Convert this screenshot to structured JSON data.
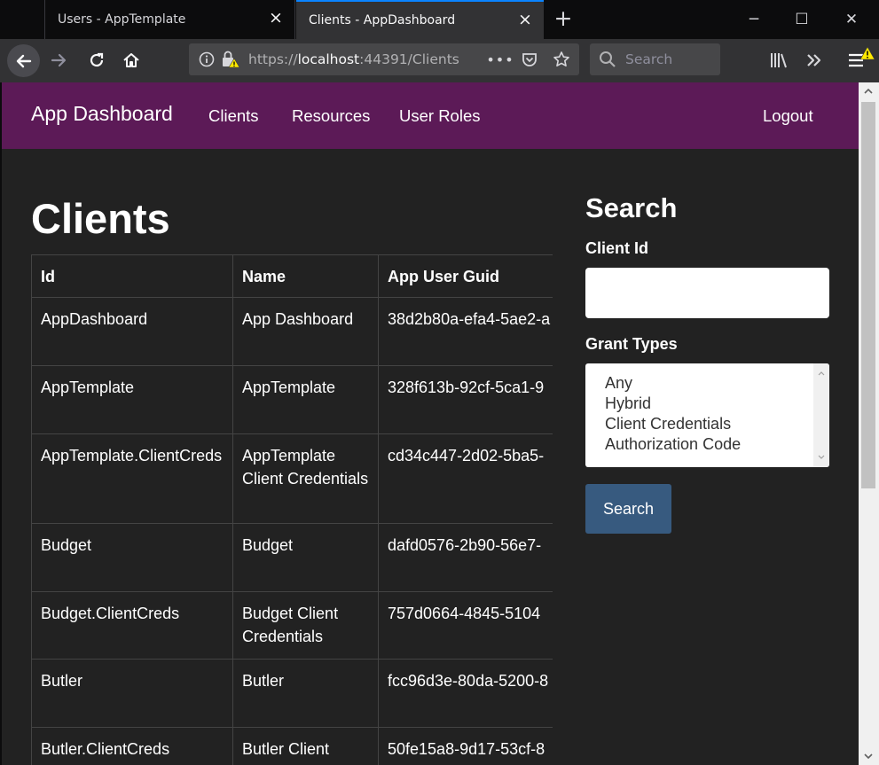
{
  "browser": {
    "tabs": [
      {
        "title": "Users - AppTemplate",
        "active": false
      },
      {
        "title": "Clients - AppDashboard",
        "active": true
      }
    ],
    "new_tab_icon": "plus-icon",
    "window_controls": {
      "minimize": "─",
      "maximize": "☐",
      "close": "✕"
    },
    "url": {
      "prefix": "https://",
      "host": "localhost",
      "rest": ":44391/Clients"
    },
    "search_placeholder": "Search",
    "icons": [
      "back-arrow-icon",
      "forward-arrow-icon",
      "reload-icon",
      "home-icon",
      "info-icon",
      "insecure-lock-icon",
      "page-actions-icon",
      "pocket-icon",
      "bookmark-star-icon",
      "search-icon",
      "library-icon",
      "overflow-icon",
      "hamburger-menu-icon"
    ]
  },
  "site": {
    "brand": "App Dashboard",
    "nav": [
      "Clients",
      "Resources",
      "User Roles"
    ],
    "logout": "Logout",
    "nav_bg": "#5c1a57"
  },
  "main": {
    "title": "Clients",
    "columns": [
      "Id",
      "Name",
      "App User Guid"
    ],
    "rows": [
      [
        "AppDashboard",
        "App Dashboard",
        "38d2b80a-efa4-5ae2-a"
      ],
      [
        "AppTemplate",
        "AppTemplate",
        "328f613b-92cf-5ca1-9"
      ],
      [
        "AppTemplate.ClientCreds",
        "AppTemplate Client Credentials",
        "cd34c447-2d02-5ba5-"
      ],
      [
        "Budget",
        "Budget",
        "dafd0576-2b90-56e7-"
      ],
      [
        "Budget.ClientCreds",
        "Budget Client Credentials",
        "757d0664-4845-5104"
      ],
      [
        "Butler",
        "Butler",
        "fcc96d3e-80da-5200-8"
      ],
      [
        "Butler.ClientCreds",
        "Butler Client",
        "50fe15a8-9d17-53cf-8"
      ]
    ]
  },
  "sidebar": {
    "title": "Search",
    "client_id_label": "Client Id",
    "client_id_value": "",
    "grant_types_label": "Grant Types",
    "grant_types": [
      "Any",
      "Hybrid",
      "Client Credentials",
      "Authorization Code"
    ],
    "search_button": "Search",
    "button_color": "#375a7f"
  }
}
